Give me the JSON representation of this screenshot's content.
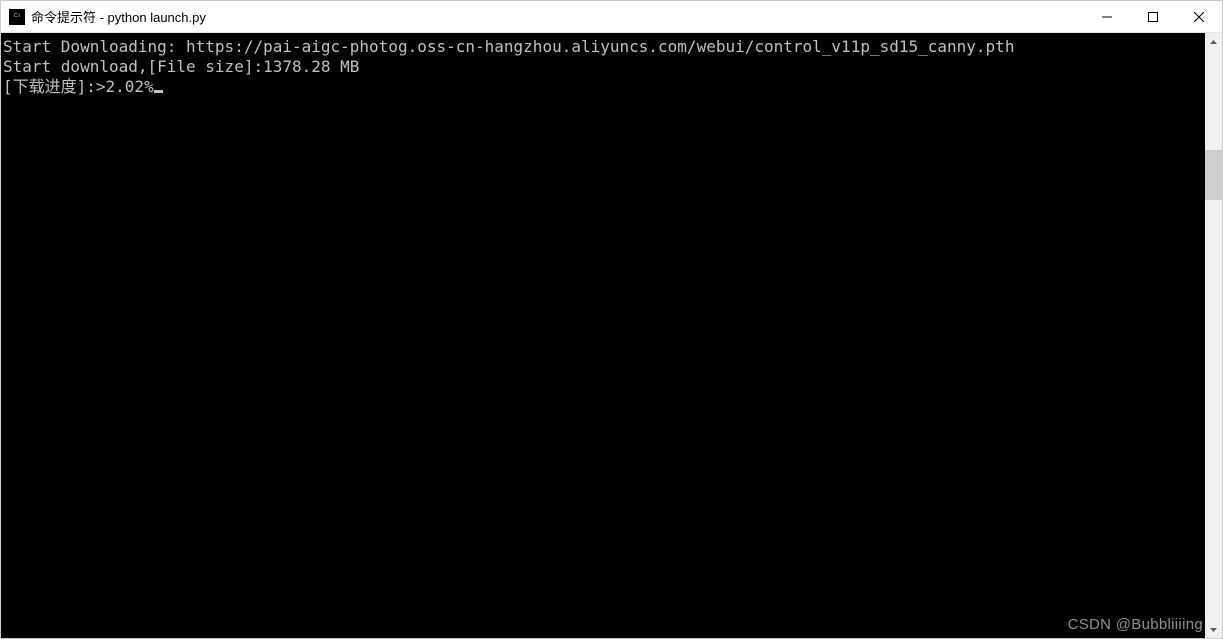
{
  "titlebar": {
    "title": "命令提示符 - python  launch.py"
  },
  "terminal": {
    "line1": "Start Downloading: https://pai-aigc-photog.oss-cn-hangzhou.aliyuncs.com/webui/control_v11p_sd15_canny.pth",
    "line2": "Start download,[File size]:1378.28 MB",
    "line3": "[下载进度]:>2.02%"
  },
  "watermark": "CSDN @Bubbliiiing"
}
